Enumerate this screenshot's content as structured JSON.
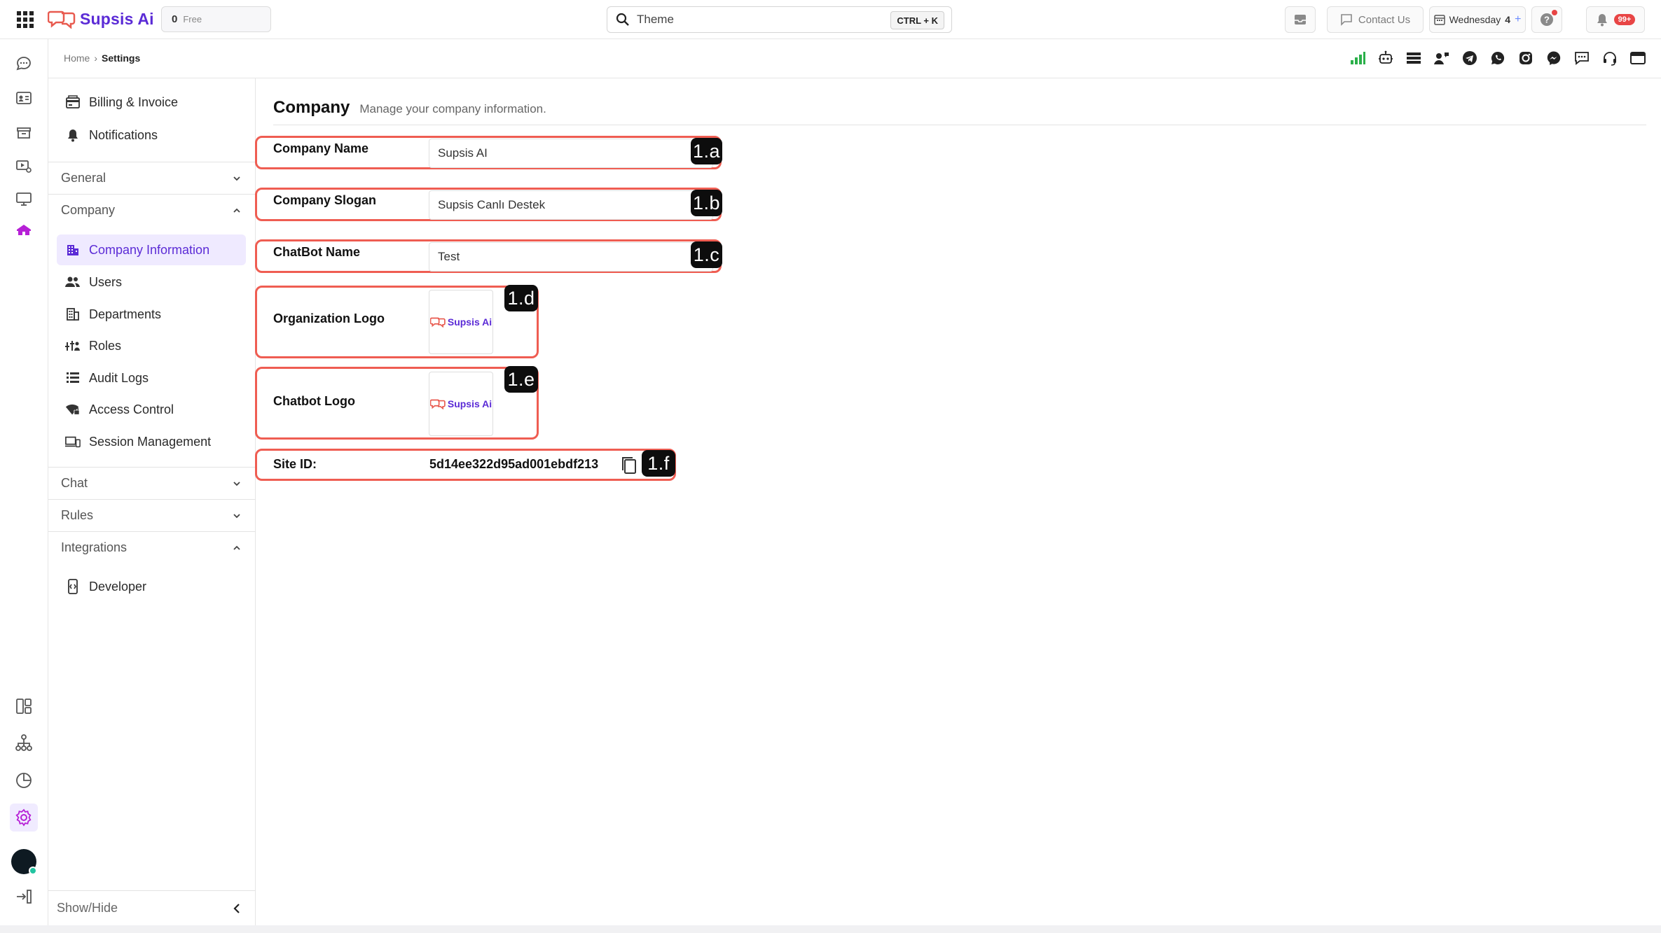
{
  "topbar": {
    "brand": "Supsis Ai",
    "plan_count": "0",
    "plan_name": "Free",
    "search_value": "Theme",
    "search_shortcut": "CTRL + K",
    "contact_label": "Contact Us",
    "date_day": "Wednesday",
    "date_num": "4",
    "notification_badge": "99+"
  },
  "breadcrumb": {
    "home": "Home",
    "separator": "›",
    "current": "Settings"
  },
  "sidebar": {
    "top_items": [
      {
        "label": "Billing & Invoice",
        "icon": "billing-icon"
      },
      {
        "label": "Notifications",
        "icon": "bell-icon"
      }
    ],
    "groups": {
      "general": "General",
      "company": "Company",
      "chat": "Chat",
      "rules": "Rules",
      "integrations": "Integrations"
    },
    "company_items": [
      {
        "label": "Company Information",
        "icon": "building-icon",
        "active": true
      },
      {
        "label": "Users",
        "icon": "users-icon"
      },
      {
        "label": "Departments",
        "icon": "departments-icon"
      },
      {
        "label": "Roles",
        "icon": "roles-icon"
      },
      {
        "label": "Audit Logs",
        "icon": "list-icon"
      },
      {
        "label": "Access Control",
        "icon": "wifi-lock-icon"
      },
      {
        "label": "Session Management",
        "icon": "devices-icon"
      }
    ],
    "integration_items": [
      {
        "label": "Developer",
        "icon": "code-icon"
      }
    ],
    "show_hide": "Show/Hide"
  },
  "main": {
    "title": "Company",
    "subtitle": "Manage your company information.",
    "fields": {
      "company_name": {
        "label": "Company Name",
        "value": "Supsis  AI",
        "tag": "1.a"
      },
      "company_slogan": {
        "label": "Company Slogan",
        "value": "Supsis Canlı  Destek",
        "tag": "1.b"
      },
      "chatbot_name": {
        "label": "ChatBot Name",
        "value": "Test",
        "tag": "1.c"
      },
      "org_logo": {
        "label": "Organization Logo",
        "logo_text": "Supsis Ai",
        "tag": "1.d"
      },
      "chatbot_logo": {
        "label": "Chatbot Logo",
        "logo_text": "Supsis Ai",
        "tag": "1.e"
      },
      "site_id": {
        "label": "Site ID:",
        "value": "5d14ee322d95ad001ebdf213",
        "tag": "1.f"
      }
    }
  },
  "colors": {
    "brand": "#5b2bd6",
    "highlight": "#ef5d52",
    "active_bg": "#efeaff",
    "bar_green": "#2bb04a"
  }
}
